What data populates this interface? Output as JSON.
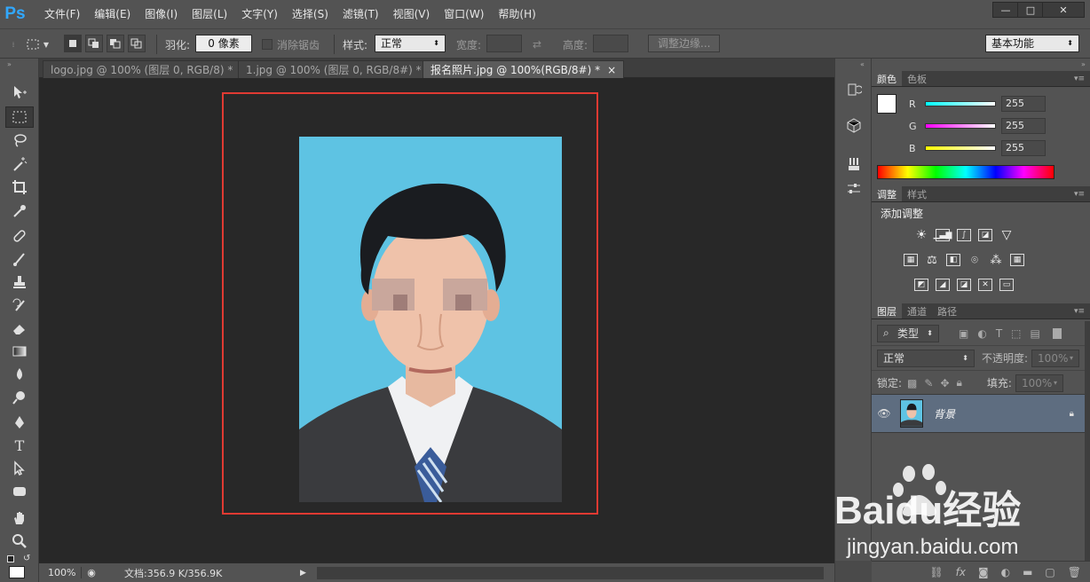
{
  "app": {
    "logo": "Ps"
  },
  "menu": [
    "文件(F)",
    "编辑(E)",
    "图像(I)",
    "图层(L)",
    "文字(Y)",
    "选择(S)",
    "滤镜(T)",
    "视图(V)",
    "窗口(W)",
    "帮助(H)"
  ],
  "window_buttons": {
    "minimize": "—",
    "restore": "□",
    "close": "✕"
  },
  "options": {
    "feather_label": "羽化:",
    "feather_value": "0 像素",
    "antialias_label": "消除锯齿",
    "style_label": "样式:",
    "style_value": "正常",
    "width_label": "宽度:",
    "height_label": "高度:",
    "refine_edge": "调整边缘...",
    "workspace": "基本功能"
  },
  "doc_tabs": [
    {
      "label": "logo.jpg @ 100% (图层 0, RGB/8) *",
      "close": "×"
    },
    {
      "label": "1.jpg @ 100% (图层 0, RGB/8#) *",
      "close": "×"
    },
    {
      "label": "报名照片.jpg @ 100%(RGB/8#) *",
      "close": "×"
    }
  ],
  "status": {
    "zoom": "100%",
    "doc_info": "文档:356.9 K/356.9K"
  },
  "color_panel": {
    "tabs": [
      "颜色",
      "色板"
    ],
    "channels": [
      {
        "label": "R",
        "value": "255",
        "color": "#00ffff"
      },
      {
        "label": "G",
        "value": "255",
        "color": "#ff00ff"
      },
      {
        "label": "B",
        "value": "255",
        "color": "#ffff00"
      }
    ]
  },
  "adjustments_panel": {
    "tabs": [
      "调整",
      "样式"
    ],
    "heading": "添加调整"
  },
  "layers_panel": {
    "tabs": [
      "图层",
      "通道",
      "路径"
    ],
    "filter_kind": "类型",
    "blend_mode": "正常",
    "opacity_label": "不透明度:",
    "opacity_value": "100%",
    "lock_label": "锁定:",
    "fill_label": "填充:",
    "fill_value": "100%",
    "layers": [
      {
        "name": "背景",
        "locked": true,
        "visible": true
      }
    ]
  },
  "watermark": {
    "brand": "Baidu经验",
    "url": "jingyan.baidu.com"
  },
  "colors": {
    "accent": "#31a8ff",
    "highlight_frame": "#e03a32",
    "photo_bg": "#5ec3e3",
    "layer_selected": "#5e6d80"
  }
}
